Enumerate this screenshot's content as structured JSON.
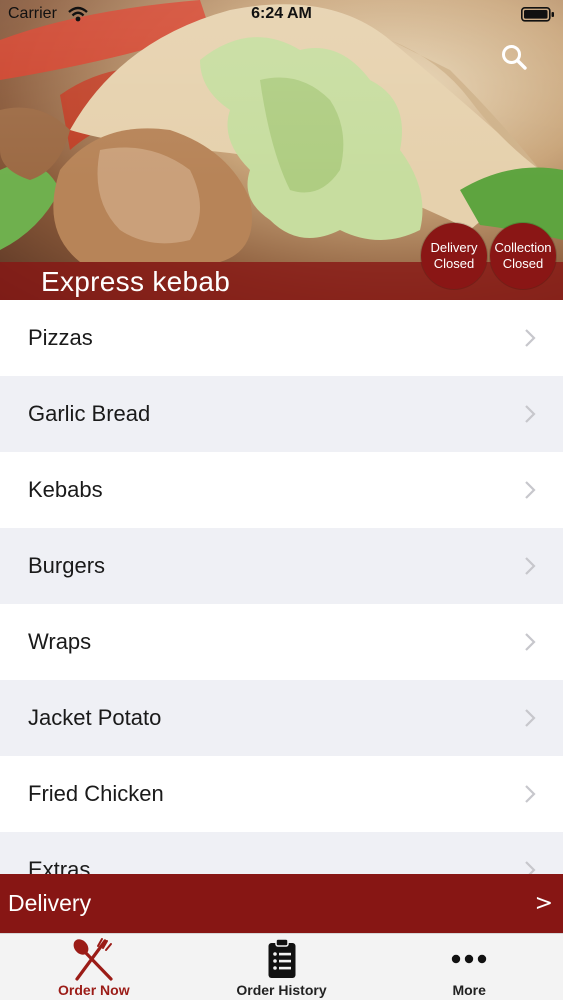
{
  "status_bar": {
    "carrier": "Carrier",
    "time": "6:24 AM"
  },
  "header": {
    "store_name": "Express kebab",
    "search_icon": "search-icon",
    "badges": [
      {
        "line1": "Delivery",
        "line2": "Closed"
      },
      {
        "line1": "Collection",
        "line2": "Closed"
      }
    ]
  },
  "categories": [
    {
      "label": "Pizzas"
    },
    {
      "label": "Garlic Bread"
    },
    {
      "label": "Kebabs"
    },
    {
      "label": "Burgers"
    },
    {
      "label": "Wraps"
    },
    {
      "label": "Jacket Potato"
    },
    {
      "label": "Fried Chicken"
    },
    {
      "label": "Extras"
    }
  ],
  "delivery_bar": {
    "label": "Delivery",
    "arrow": ">"
  },
  "tabbar": {
    "tabs": [
      {
        "label": "Order Now",
        "icon": "fork-knife-icon",
        "active": true
      },
      {
        "label": "Order History",
        "icon": "clipboard-list-icon",
        "active": false
      },
      {
        "label": "More",
        "icon": "more-dots-icon",
        "active": false
      }
    ]
  },
  "colors": {
    "brand": "#871614",
    "active_tab": "#9b1c17",
    "row_alt": "#eff0f5"
  }
}
